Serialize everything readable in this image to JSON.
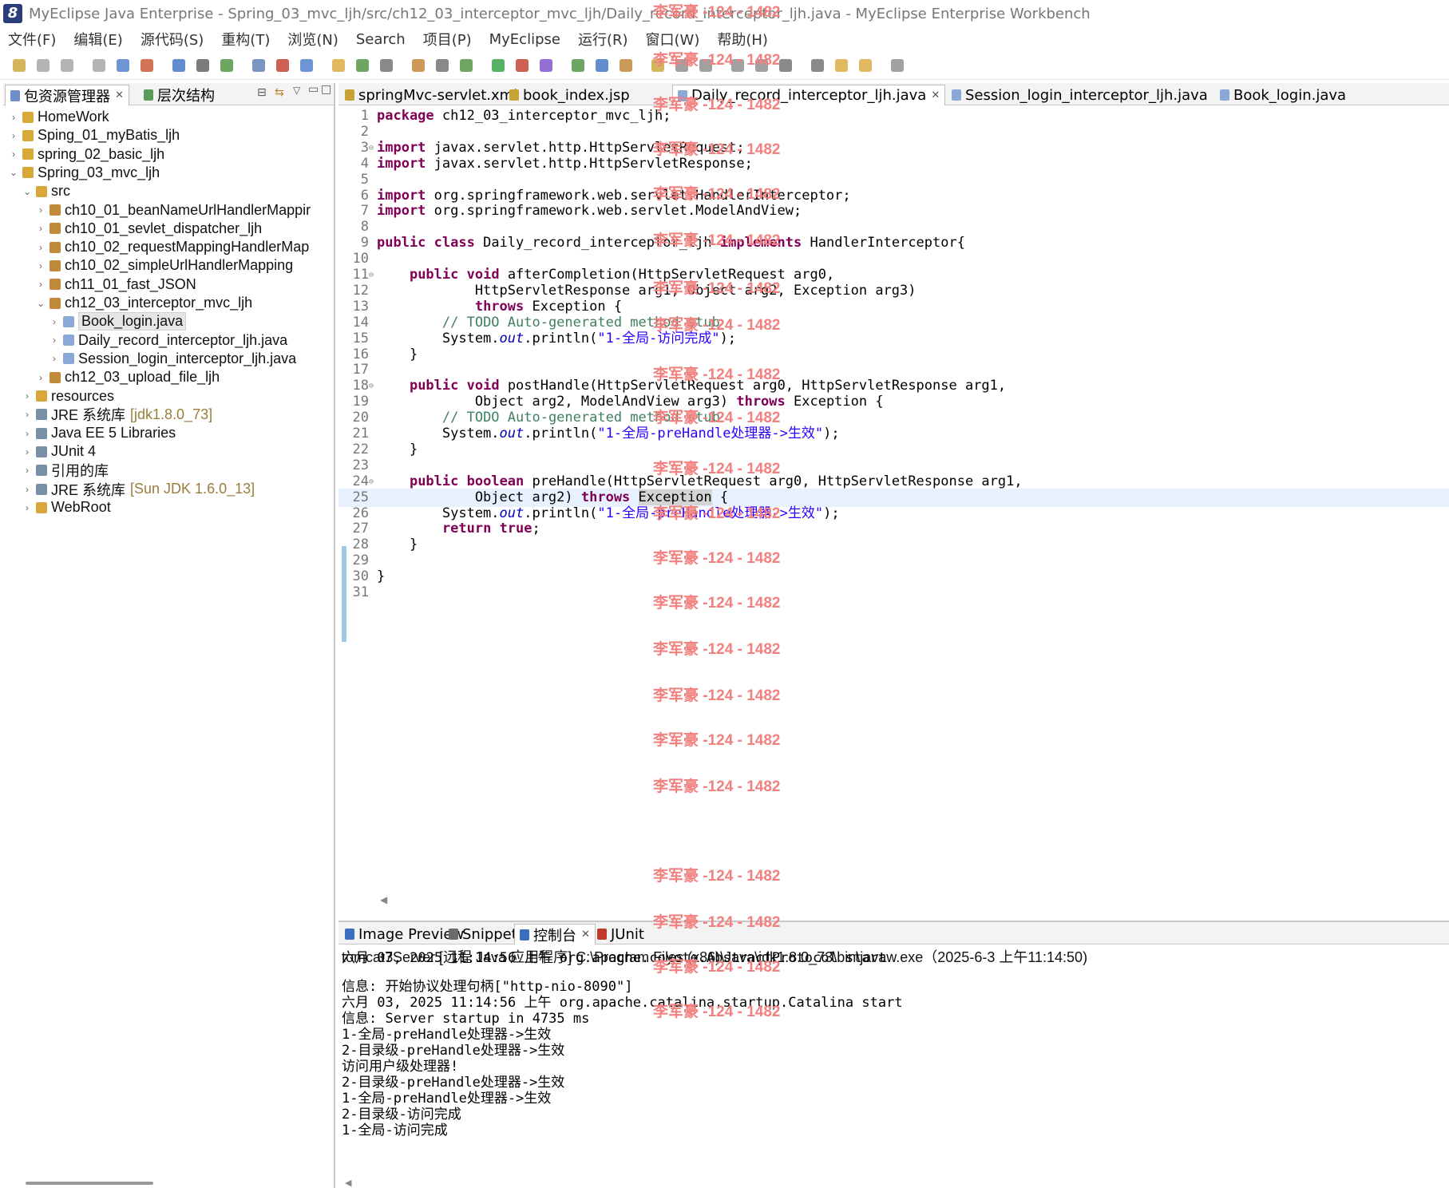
{
  "window": {
    "title": "MyEclipse Java Enterprise  -  Spring_03_mvc_ljh/src/ch12_03_interceptor_mvc_ljh/Daily_record_interceptor_ljh.java  -  MyEclipse Enterprise Workbench"
  },
  "menu": [
    "文件(F)",
    "编辑(E)",
    "源代码(S)",
    "重构(T)",
    "浏览(N)",
    "Search",
    "项目(P)",
    "MyEclipse",
    "运行(R)",
    "窗口(W)",
    "帮助(H)"
  ],
  "left_tabs": [
    {
      "label": "包资源管理器"
    },
    {
      "label": "层次结构"
    }
  ],
  "tree": [
    {
      "label": "HomeWork",
      "level": 0,
      "expanded": false
    },
    {
      "label": "Sping_01_myBatis_ljh",
      "level": 0,
      "expanded": false
    },
    {
      "label": "spring_02_basic_ljh",
      "level": 0,
      "expanded": false
    },
    {
      "label": "Spring_03_mvc_ljh",
      "level": 0,
      "expanded": true
    },
    {
      "label": "src",
      "level": 1,
      "expanded": true
    },
    {
      "label": "ch10_01_beanNameUrlHandlerMappir",
      "level": 2,
      "expanded": false
    },
    {
      "label": "ch10_01_sevlet_dispatcher_ljh",
      "level": 2,
      "expanded": false
    },
    {
      "label": "ch10_02_requestMappingHandlerMap",
      "level": 2,
      "expanded": false
    },
    {
      "label": "ch10_02_simpleUrlHandlerMapping",
      "level": 2,
      "expanded": false
    },
    {
      "label": "ch11_01_fast_JSON",
      "level": 2,
      "expanded": false
    },
    {
      "label": "ch12_03_interceptor_mvc_ljh",
      "level": 2,
      "expanded": true
    },
    {
      "label": "Book_login.java",
      "level": 3,
      "expanded": false,
      "selected": true
    },
    {
      "label": "Daily_record_interceptor_ljh.java",
      "level": 3,
      "expanded": false
    },
    {
      "label": "Session_login_interceptor_ljh.java",
      "level": 3,
      "expanded": false
    },
    {
      "label": "ch12_03_upload_file_ljh",
      "level": 2,
      "expanded": false
    },
    {
      "label": "resources",
      "level": 1,
      "expanded": false
    },
    {
      "label": "JRE 系统库",
      "extra": "[jdk1.8.0_73]",
      "level": 1,
      "expanded": false
    },
    {
      "label": "Java EE 5 Libraries",
      "level": 1,
      "expanded": false
    },
    {
      "label": "JUnit 4",
      "level": 1,
      "expanded": false
    },
    {
      "label": "引用的库",
      "level": 1,
      "expanded": false
    },
    {
      "label": "JRE 系统库",
      "extra": "[Sun JDK 1.6.0_13]",
      "level": 1,
      "expanded": false
    },
    {
      "label": "WebRoot",
      "level": 1,
      "expanded": false
    }
  ],
  "editor_tabs": [
    {
      "label": "springMvc-servlet.xml",
      "active": false
    },
    {
      "label": "book_index.jsp",
      "active": false
    },
    {
      "label": "Daily_record_interceptor_ljh.java",
      "active": true
    },
    {
      "label": "Session_login_interceptor_ljh.java",
      "active": false
    },
    {
      "label": "Book_login.java",
      "active": false
    }
  ],
  "code_lines": [
    "package ch12_03_interceptor_mvc_ljh;",
    "",
    "import javax.servlet.http.HttpServletRequest;",
    "import javax.servlet.http.HttpServletResponse;",
    "",
    "import org.springframework.web.servlet.HandlerInterceptor;",
    "import org.springframework.web.servlet.ModelAndView;",
    "",
    "public class Daily_record_interceptor_ljh implements HandlerInterceptor{",
    "",
    "    public void afterCompletion(HttpServletRequest arg0,",
    "            HttpServletResponse arg1, Object arg2, Exception arg3)",
    "            throws Exception {",
    "        // TODO Auto-generated method stub",
    "        System.out.println(\"1-全局-访问完成\");",
    "    }",
    "",
    "    public void postHandle(HttpServletRequest arg0, HttpServletResponse arg1,",
    "            Object arg2, ModelAndView arg3) throws Exception {",
    "        // TODO Auto-generated method stub",
    "        System.out.println(\"1-全局-preHandle处理器->生效\");",
    "    }",
    "",
    "    public boolean preHandle(HttpServletRequest arg0, HttpServletResponse arg1,",
    "            Object arg2) throws Exception {",
    "        System.out.println(\"1-全局-preHandle处理器->生效\");",
    "        return true;",
    "    }",
    "",
    "}",
    ""
  ],
  "bottom_tabs": [
    {
      "label": "Image Preview",
      "active": false
    },
    {
      "label": "Snippets",
      "active": false
    },
    {
      "label": "控制台",
      "active": true
    },
    {
      "label": "JUnit",
      "active": false
    }
  ],
  "console": {
    "header": "tomcat7Server [远程 Java 应用程序] C:\\Program Files (x86)\\Java\\jdk1.8.0_73\\bin\\javaw.exe（2025-6-3 上午11:14:50)",
    "lines": [
      "六月 03, 2025 11:14:56 上午 org.apache.coyote.AbstractProtocol start",
      "信息: 开始协议处理句柄[\"http-nio-8090\"]",
      "六月 03, 2025 11:14:56 上午 org.apache.catalina.startup.Catalina start",
      "信息: Server startup in 4735 ms",
      "1-全局-preHandle处理器->生效",
      "2-目录级-preHandle处理器->生效",
      "访问用户级处理器!",
      "2-目录级-preHandle处理器->生效",
      "1-全局-preHandle处理器->生效",
      "2-目录级-访问完成",
      "1-全局-访问完成"
    ]
  },
  "watermark": "李军豪 -124 - 1482"
}
